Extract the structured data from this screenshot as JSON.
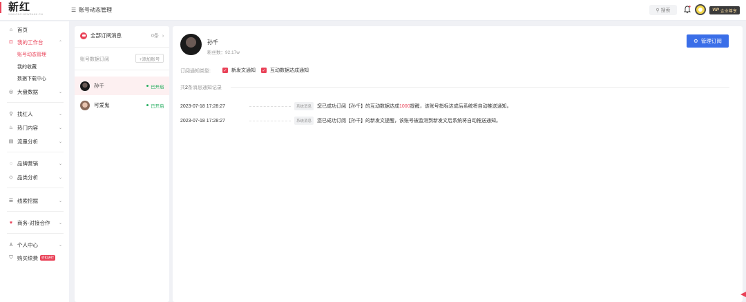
{
  "app": {
    "logo": "新红",
    "logo_sub": "XINHONG.NEWRANK.CN",
    "menu_icon": "menu-icon",
    "page_heading": "账号动态管理",
    "search_label": "搜索",
    "vip_label": "VIP",
    "vip_sub": "企业尊享",
    "brand_color": "#e94157",
    "accent_color": "#3a6ee8"
  },
  "nav": {
    "home": "首页",
    "workbench": "我的工作台",
    "sub_account_mgmt": "账号动态管理",
    "sub_favorites": "我的收藏",
    "sub_downloads": "数据下载中心",
    "market": "大盘数据",
    "find_kol": "找红人",
    "hot_content": "热门内容",
    "traffic": "流量分析",
    "brand": "品牌营销",
    "category": "品类分析",
    "clue": "线索挖掘",
    "coop": "商务-对接合作",
    "personal": "个人中心",
    "buy": "购买续费",
    "buy_badge": "折扣进行"
  },
  "subscriptions": {
    "all_title": "全部订阅消息",
    "all_count": "0条",
    "section_title": "账号数据订阅",
    "add_button": "+添加账号",
    "accounts": [
      {
        "name": "孙千",
        "status": "已开启"
      },
      {
        "name": "可爱鬼",
        "status": "已开启"
      }
    ]
  },
  "detail": {
    "name": "孙千",
    "fans": "粉丝数：92.17w",
    "manage_button": "管理订阅",
    "notify_label": "订阅通知类型:",
    "types": [
      "新发文通知",
      "互动数据达成通知"
    ],
    "total_prefix": "共",
    "total_count": "2",
    "total_suffix": "条消息通知记录",
    "logs": [
      {
        "time": "2023-07-18 17:28:27",
        "tag": "系统消息",
        "text_a": "您已成功订阅【孙千】的互动数据达成",
        "text_red": "1000",
        "text_b": "提醒，该账号指标达成后系统将自动推送通知。"
      },
      {
        "time": "2023-07-18 17:28:27",
        "tag": "系统消息",
        "text_a": "您已成功订阅【孙千】的新发文提醒，该账号被监测到新发文后系统将自动推送通知。",
        "text_red": "",
        "text_b": ""
      }
    ]
  }
}
